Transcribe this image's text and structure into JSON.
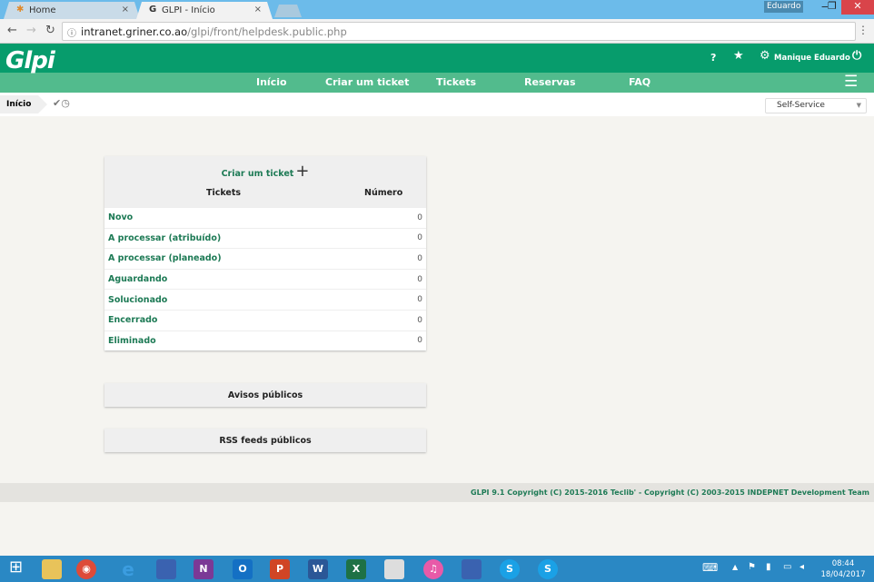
{
  "browser": {
    "tabs": [
      {
        "title": "Home"
      },
      {
        "title": "GLPI - Início"
      }
    ],
    "url_host": "intranet.griner.co.ao",
    "url_path": "/glpi/front/helpdesk.public.php",
    "user_badge": "Eduardo"
  },
  "header": {
    "logo": "Glpi",
    "help": "?",
    "user": "Manique Eduardo"
  },
  "nav": {
    "items": [
      "Início",
      "Criar um ticket",
      "Tickets",
      "Reservas",
      "FAQ"
    ]
  },
  "breadcrumb": {
    "current": "Início"
  },
  "profile_select": {
    "value": "Self-Service"
  },
  "tickets_panel": {
    "create_label": "Criar um ticket",
    "col_tickets": "Tickets",
    "col_number": "Número",
    "rows": [
      {
        "label": "Novo",
        "count": "0"
      },
      {
        "label": "A processar (atribuído)",
        "count": "0"
      },
      {
        "label": "A processar (planeado)",
        "count": "0"
      },
      {
        "label": "Aguardando",
        "count": "0"
      },
      {
        "label": "Solucionado",
        "count": "0"
      },
      {
        "label": "Encerrado",
        "count": "0"
      },
      {
        "label": "Eliminado",
        "count": "0"
      }
    ]
  },
  "public_notices": "Avisos públicos",
  "rss_feeds": "RSS feeds públicos",
  "footer": "GLPI 9.1 Copyright (C) 2015-2016 Teclib' - Copyright (C) 2003-2015 INDEPNET Development Team",
  "taskbar": {
    "time": "08:44",
    "date": "18/04/2017"
  },
  "colors": {
    "header": "#079c6c",
    "nav": "#52bb8d",
    "link": "#1d7a55"
  }
}
